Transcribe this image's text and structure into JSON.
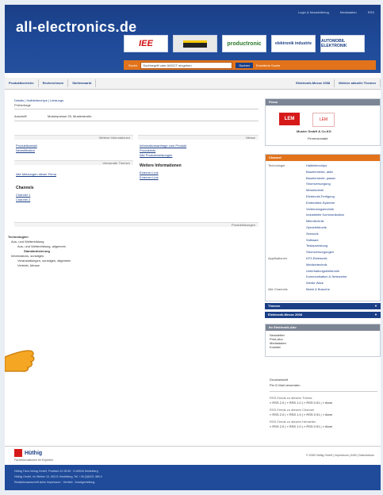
{
  "header": {
    "logo_text": "all-electronics.de",
    "top_links": [
      "Login & Newsletterlog",
      "Mediadaten",
      "RSS"
    ],
    "brands": [
      "IEE",
      "",
      "productronic",
      "elektronik industrie",
      "AUTOMOBIL ELEKTRONIK"
    ],
    "search": {
      "label": "Suche",
      "placeholder": "Suchbegriff oder ANSCT eingeben",
      "button": "Suchen",
      "advanced": "Erweiterte Suche"
    }
  },
  "nav": {
    "tabs": [
      "Produktbereiche",
      "Rechercheure",
      "Stellenmarkt"
    ],
    "right_tabs": [
      "Elektronik-Messe 2008",
      "Weitere aktuelle Themen"
    ]
  },
  "breadcrumb": "Details | Halbleiterchips | Leistungs",
  "page_title": "Prüfanfrage",
  "main": {
    "company_label": "Anschrift",
    "company_value": "Musterpresse 25, Musterstraße",
    "section_more": "Weitere Informationen",
    "section_dates": "Messe",
    "section_related": "Verwandte Themen",
    "section_products": "Produktlösungen",
    "left_links": [
      "Produktkontakt",
      "Newsfiltration",
      "Alle Meldungen dieser Firma"
    ],
    "right_links": [
      "Informationsanfrage zum Produkt",
      "Produktinfo",
      "Alle Produktmeldungen"
    ],
    "more_info_heading": "Weitere Informationen",
    "more_info_links": [
      "Externer Link",
      "Externer Link"
    ],
    "channels_heading": "Channels",
    "channel_links": [
      "Channel 1",
      "Channel 2"
    ],
    "tech_heading": "Technologien",
    "tech_lines": [
      "Aus- und Weiterbildung",
      "Aus- und Weiterbildung, allgemein",
      "Standardisierung",
      "Informations, sonstiges",
      "Veranstaltungen, sonstiges, allgemein",
      "Vertrieb, Messe"
    ]
  },
  "sidebar": {
    "company_head": "Firma",
    "company_name": "Muster GmbH & Co.KG",
    "company_sub": "Firmenkontakt",
    "logo_text": "LEM",
    "channel_head": "Channel",
    "channel_rows": [
      {
        "k": "Technologie",
        "v": "Halbleiterchips"
      },
      {
        "k": "",
        "v": "Bauelemente, aktiv"
      },
      {
        "k": "",
        "v": "Bauelemente, passiv"
      },
      {
        "k": "",
        "v": "Stromversorgung"
      },
      {
        "k": "",
        "v": "Messtechnik"
      },
      {
        "k": "",
        "v": "Elektronik-Fertigung"
      },
      {
        "k": "",
        "v": "Embedded-Systeme"
      },
      {
        "k": "",
        "v": "Verbindungstechnik"
      },
      {
        "k": "",
        "v": "Industrielle Kommunikation"
      },
      {
        "k": "",
        "v": "Mikrotechnik"
      },
      {
        "k": "",
        "v": "Optoelektronik"
      },
      {
        "k": "",
        "v": "Sensorik"
      },
      {
        "k": "",
        "v": "Software"
      },
      {
        "k": "",
        "v": "Testausrüstung"
      },
      {
        "k": "",
        "v": "Stromversorgungen"
      },
      {
        "k": "Applikationen",
        "v": "KFZ-Elektronik"
      },
      {
        "k": "",
        "v": "Medizintechnik"
      },
      {
        "k": "",
        "v": "Unterhaltungselektronik"
      },
      {
        "k": "",
        "v": "Kommunikation & Netzwerke"
      },
      {
        "k": "",
        "v": "Weiße Ware"
      },
      {
        "k": "Alle Channels",
        "v": "Markt & Branche"
      }
    ],
    "themes_bar": "Themen",
    "messe_bar": "Elektronik-Messe 2008",
    "service_head": "Ihr Elektronik-Abo",
    "service_links": [
      "Newsletter",
      "Print-Abo",
      "Mediadaten",
      "Kontakt"
    ],
    "print_links": [
      "Druckansicht",
      "Per E-Mail versenden"
    ],
    "more1": "RSS-Feeds zu diesem Thema",
    "more1_vals": "» RSS 2.0 | » RSS 1.0 | » RSS 0.91 | » Atom",
    "more2": "RSS-Feeds zu diesem Channel",
    "more2_vals": "» RSS 2.0 | » RSS 1.0 | » RSS 0.91 | » Atom",
    "more3": "RSS-Feeds zu diesem Hersteller",
    "more3_vals": "» RSS 2.0 | » RSS 1.0 | » RSS 0.91 | » Atom"
  },
  "footer": {
    "logo": "Hüthig",
    "sub": "Fachinformationen für Experten",
    "right": "© 2008 Hüthig GmbH | Impressum | AGB | Datenschutz",
    "lines": [
      "Hüthig Fach-Verlag GmbH, Postfach 10 28 69 · D-69018 Heidelberg",
      "Hüthig GmbH, Im Weiher 10, 69121 Heidelberg, Tel. +49 (0)6221 489-0",
      "Redaktionsanschrift siehe Impressum · Vertrieb · Anzeigenleitung"
    ]
  }
}
